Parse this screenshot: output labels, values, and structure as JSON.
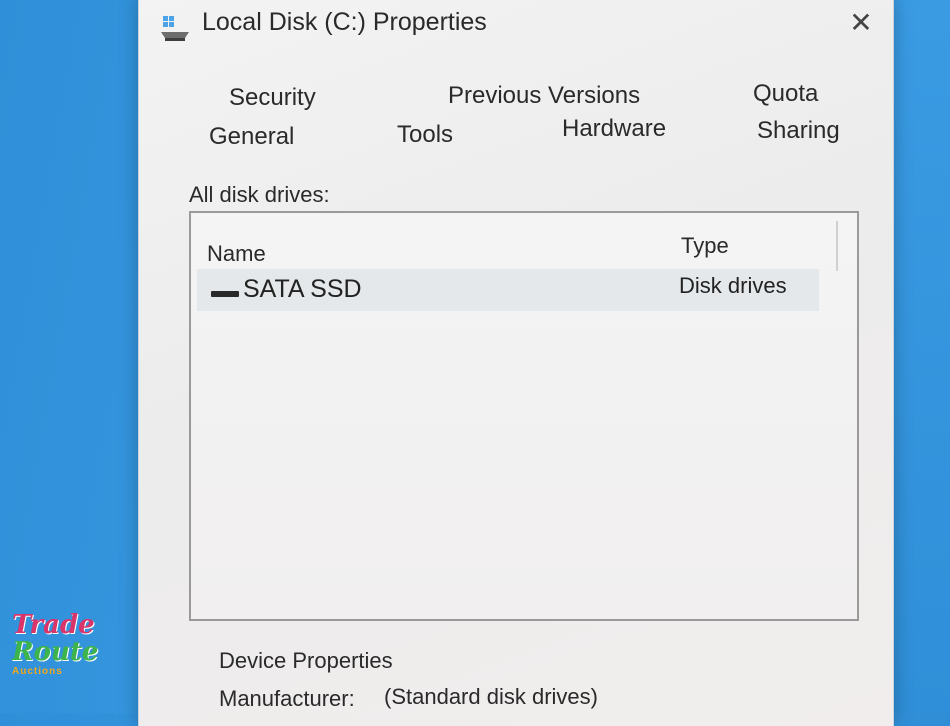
{
  "window": {
    "title": "Local Disk (C:) Properties",
    "close_glyph": "✕"
  },
  "tabs": {
    "security": "Security",
    "previous_versions": "Previous Versions",
    "quota": "Quota",
    "general": "General",
    "tools": "Tools",
    "hardware": "Hardware",
    "sharing": "Sharing"
  },
  "hardware": {
    "section_label": "All disk drives:",
    "columns": {
      "name": "Name",
      "type": "Type"
    },
    "rows": [
      {
        "name": "SATA SSD",
        "type": "Disk drives",
        "icon": "drive-icon"
      }
    ],
    "device_properties_label": "Device Properties",
    "manufacturer_label": "Manufacturer:",
    "manufacturer_value": "(Standard disk drives)"
  },
  "watermark": {
    "line1": "Trade",
    "line2": "Route",
    "line3": "Auctions"
  },
  "colors": {
    "desktop": "#3c9ee6",
    "dialog": "#f1f1f1",
    "selected_row": "#e4e8ea"
  }
}
